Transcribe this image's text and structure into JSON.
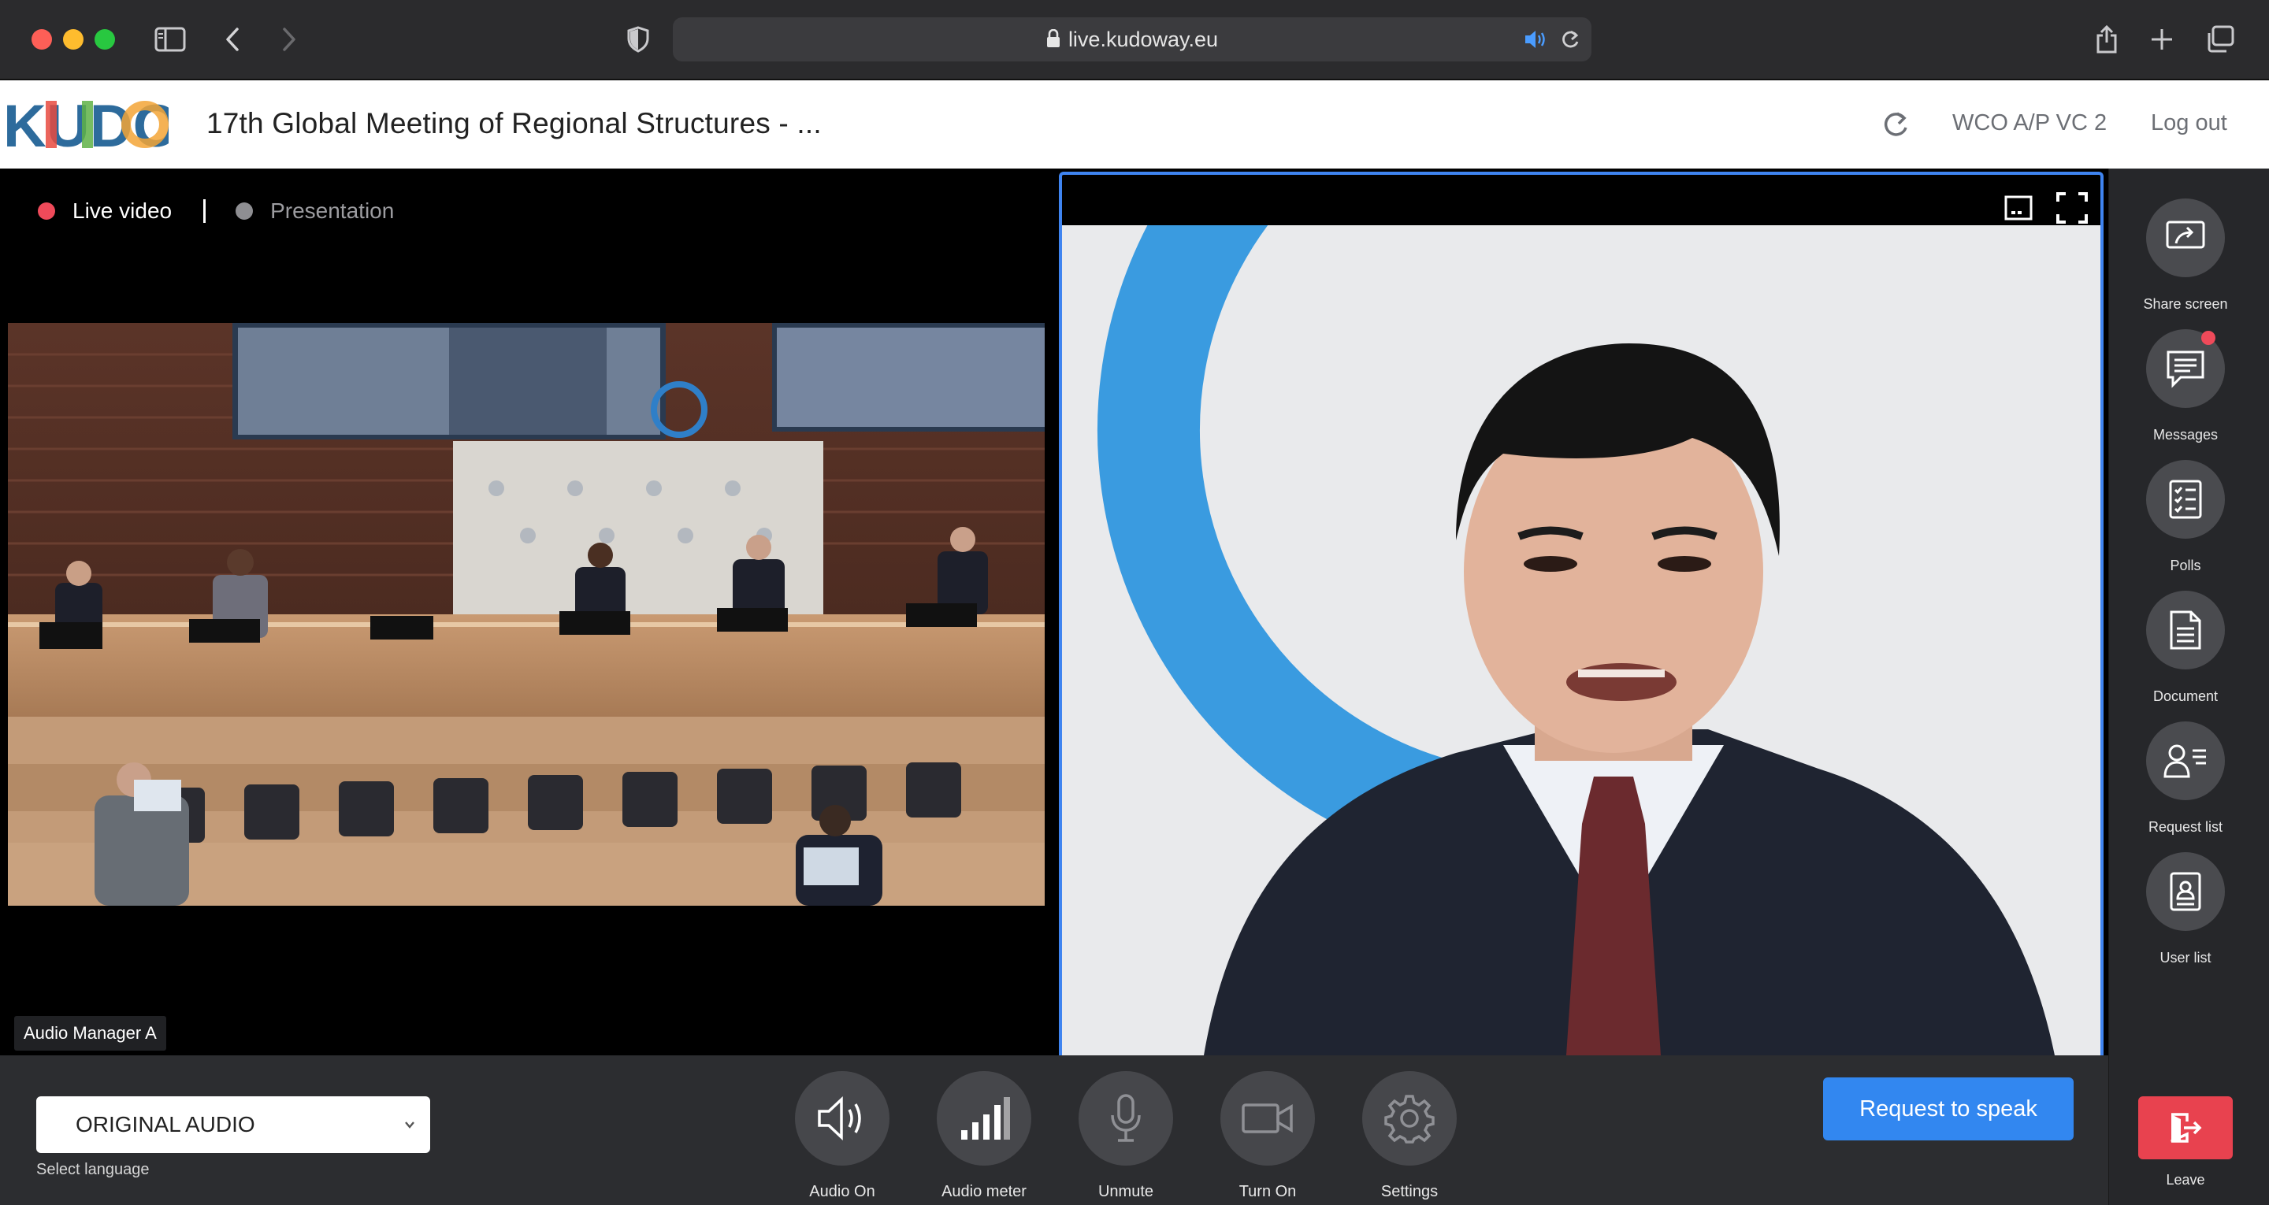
{
  "browser": {
    "url": "live.kudoway.eu"
  },
  "header": {
    "logo_text": "KUDO",
    "meeting_title": "17th Global Meeting of Regional Structures - ...",
    "room_name": "WCO A/P VC 2",
    "logout_label": "Log out"
  },
  "video": {
    "tabs": [
      {
        "label": "Live video",
        "active": true
      },
      {
        "label": "Presentation",
        "active": false
      }
    ],
    "speaker_label": "Audio Manager A"
  },
  "sidebar": {
    "items": [
      {
        "label": "Share screen",
        "icon": "share-screen-icon"
      },
      {
        "label": "Messages",
        "icon": "messages-icon",
        "notification": true
      },
      {
        "label": "Polls",
        "icon": "polls-icon"
      },
      {
        "label": "Document",
        "icon": "document-icon"
      },
      {
        "label": "Request list",
        "icon": "request-list-icon"
      },
      {
        "label": "User list",
        "icon": "user-list-icon"
      }
    ],
    "leave_label": "Leave"
  },
  "controls": {
    "language_value": "ORIGINAL AUDIO",
    "language_hint": "Select language",
    "buttons": [
      {
        "label": "Audio On",
        "icon": "speaker-icon"
      },
      {
        "label": "Audio meter",
        "icon": "audio-meter-icon"
      },
      {
        "label": "Unmute",
        "icon": "microphone-icon"
      },
      {
        "label": "Turn On",
        "icon": "camera-icon"
      },
      {
        "label": "Settings",
        "icon": "gear-icon"
      }
    ],
    "request_label": "Request to speak"
  },
  "colors": {
    "accent_blue": "#3287f0",
    "live_red": "#ef4a5a",
    "leave_red": "#e8424f"
  }
}
